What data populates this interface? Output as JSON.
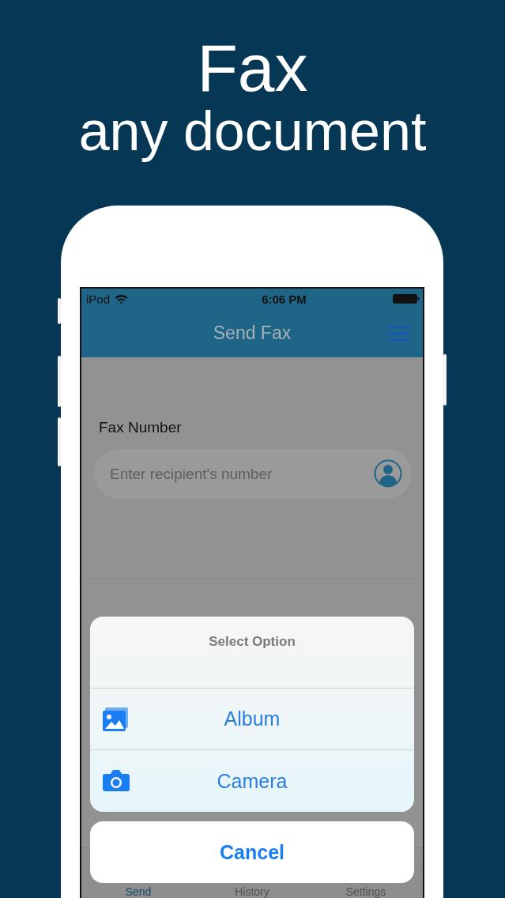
{
  "headline": {
    "title": "Fax",
    "subtitle": "any document"
  },
  "status_bar": {
    "carrier": "iPod",
    "time": "6:06 PM"
  },
  "nav": {
    "title": "Send Fax"
  },
  "form": {
    "label": "Fax Number",
    "placeholder": "Enter recipient's number"
  },
  "action_sheet": {
    "title": "Select Option",
    "options": [
      {
        "label": "Album",
        "kind": "album"
      },
      {
        "label": "Camera",
        "kind": "camera"
      }
    ],
    "cancel": "Cancel"
  },
  "tabs": [
    {
      "label": "Send",
      "selected": true
    },
    {
      "label": "History",
      "selected": false
    },
    {
      "label": "Settings",
      "selected": false
    }
  ]
}
